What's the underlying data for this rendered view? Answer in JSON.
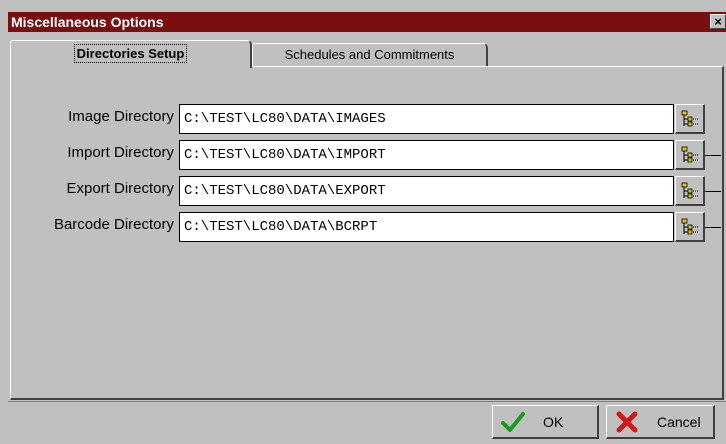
{
  "window": {
    "title": "Miscellaneous Options",
    "close_glyph": "×"
  },
  "tabs": [
    {
      "label": "Directories Setup",
      "active": true
    },
    {
      "label": "Schedules and Commitments",
      "active": false
    }
  ],
  "directories": [
    {
      "label": "Image Directory",
      "value": "C:\\TEST\\LC80\\DATA\\IMAGES",
      "icon": "folder-tree-icon"
    },
    {
      "label": "Import Directory",
      "value": "C:\\TEST\\LC80\\DATA\\IMPORT",
      "icon": "folder-tree-icon"
    },
    {
      "label": "Export Directory",
      "value": "C:\\TEST\\LC80\\DATA\\EXPORT",
      "icon": "folder-tree-icon"
    },
    {
      "label": "Barcode Directory",
      "value": "C:\\TEST\\LC80\\DATA\\BCRPT",
      "icon": "folder-tree-icon"
    }
  ],
  "buttons": {
    "ok": {
      "label": "OK",
      "icon": "checkmark-icon",
      "color": "#1a9a1a"
    },
    "cancel": {
      "label": "Cancel",
      "icon": "red-x-icon",
      "color": "#d01818"
    }
  },
  "colors": {
    "titlebar": "#7b0e0e",
    "face": "#c0c0c0"
  }
}
